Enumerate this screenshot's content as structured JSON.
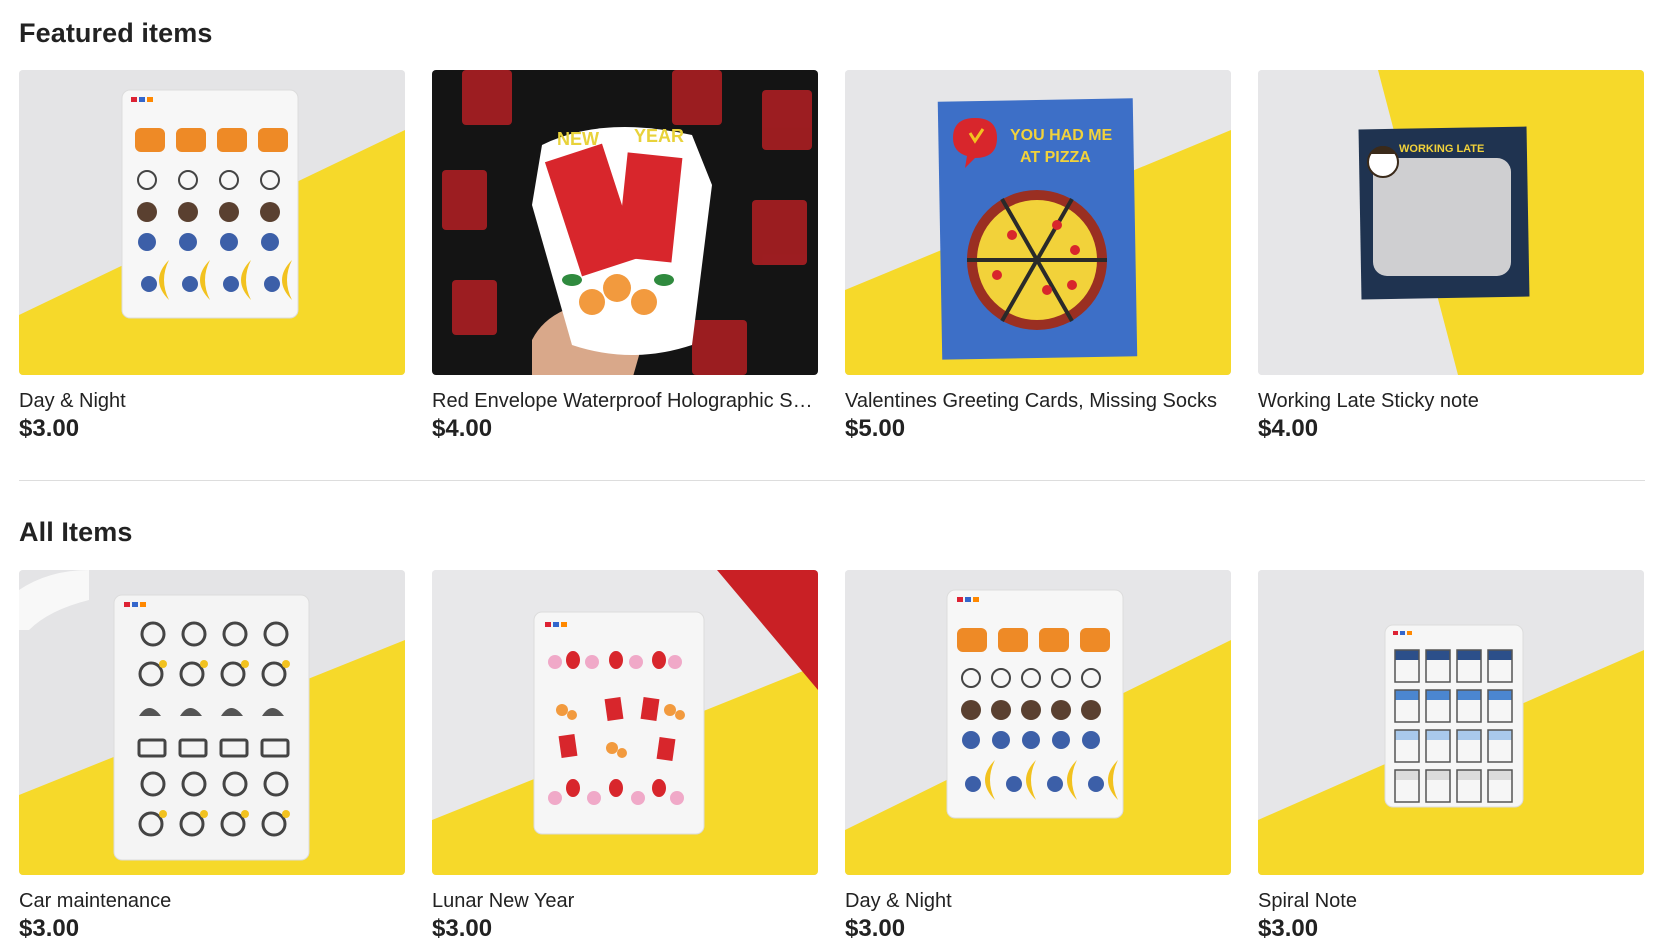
{
  "featured": {
    "title": "Featured items",
    "items": [
      {
        "title": "Day & Night",
        "price": "$3.00",
        "image_icon": "day-night-sticker-sheet"
      },
      {
        "title": "Red Envelope Waterproof Holographic Sticker",
        "price": "$4.00",
        "image_icon": "red-envelope-sticker"
      },
      {
        "title": "Valentines Greeting Cards, Missing Socks",
        "price": "$5.00",
        "image_icon": "pizza-greeting-card",
        "card_text": "YOU HAD ME AT PIZZA"
      },
      {
        "title": "Working Late Sticky note",
        "price": "$4.00",
        "image_icon": "working-late-sticky-note",
        "note_text": "WORKING LATE"
      }
    ]
  },
  "all_items": {
    "title": "All Items",
    "items": [
      {
        "title": "Car maintenance",
        "price": "$3.00",
        "image_icon": "car-maintenance-sticker-sheet"
      },
      {
        "title": "Lunar New Year",
        "price": "$3.00",
        "image_icon": "lunar-new-year-sticker-sheet"
      },
      {
        "title": "Day & Night",
        "price": "$3.00",
        "image_icon": "day-night-sticker-sheet"
      },
      {
        "title": "Spiral Note",
        "price": "$3.00",
        "image_icon": "spiral-note-sticker-sheet"
      }
    ]
  },
  "colors": {
    "yellow_bg": "#f6d92a",
    "grey_bg": "#e4e4e6",
    "card_blue": "#3d6fc7",
    "envelope_red": "#d8262c",
    "note_navy": "#1f3350"
  }
}
